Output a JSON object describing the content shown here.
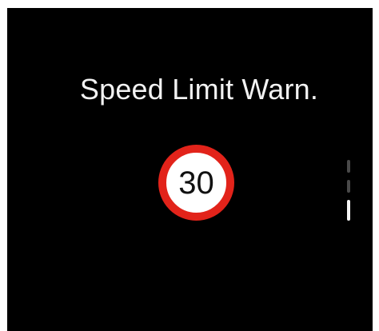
{
  "screen": {
    "title": "Speed Limit Warn.",
    "speed_sign": {
      "value": "30",
      "ring_color": "#e2231a",
      "face_color": "#ffffff"
    },
    "page_indicator": {
      "total": 3,
      "active_index": 3
    }
  }
}
